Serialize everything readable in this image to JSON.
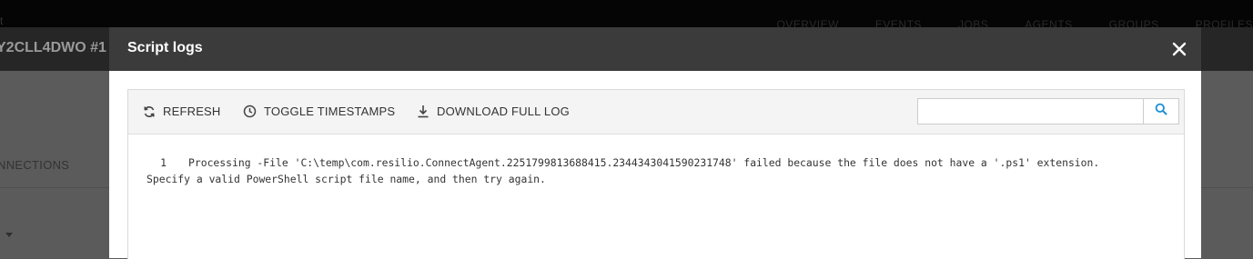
{
  "background": {
    "nav_items": [
      "OVERVIEW",
      "EVENTS",
      "JOBS",
      "AGENTS",
      "GROUPS",
      "PROFILES"
    ],
    "app_title": "Y2CLL4DWO #1",
    "tab_label": "NNECTIONS",
    "corner_text": "t"
  },
  "modal": {
    "title": "Script logs",
    "close_icon": "close-icon"
  },
  "toolbar": {
    "refresh_label": "REFRESH",
    "toggle_timestamps_label": "TOGGLE TIMESTAMPS",
    "download_label": "DOWNLOAD FULL LOG",
    "search_placeholder": "",
    "icons": {
      "refresh": "refresh-icon",
      "timestamps": "clock-icon",
      "download": "download-icon",
      "search": "search-icon"
    }
  },
  "log": {
    "lines": [
      {
        "number": "1",
        "text": "Processing -File 'C:\\temp\\com.resilio.ConnectAgent.2251799813688415.2344343041590231748' failed because the file does not have a '.ps1' extension.",
        "continuation": "Specify a valid PowerShell script file name, and then try again."
      }
    ]
  },
  "colors": {
    "header_bg": "#3b3b3b",
    "toolbar_bg": "#f4f4f4",
    "search_icon": "#1a8fd6"
  }
}
